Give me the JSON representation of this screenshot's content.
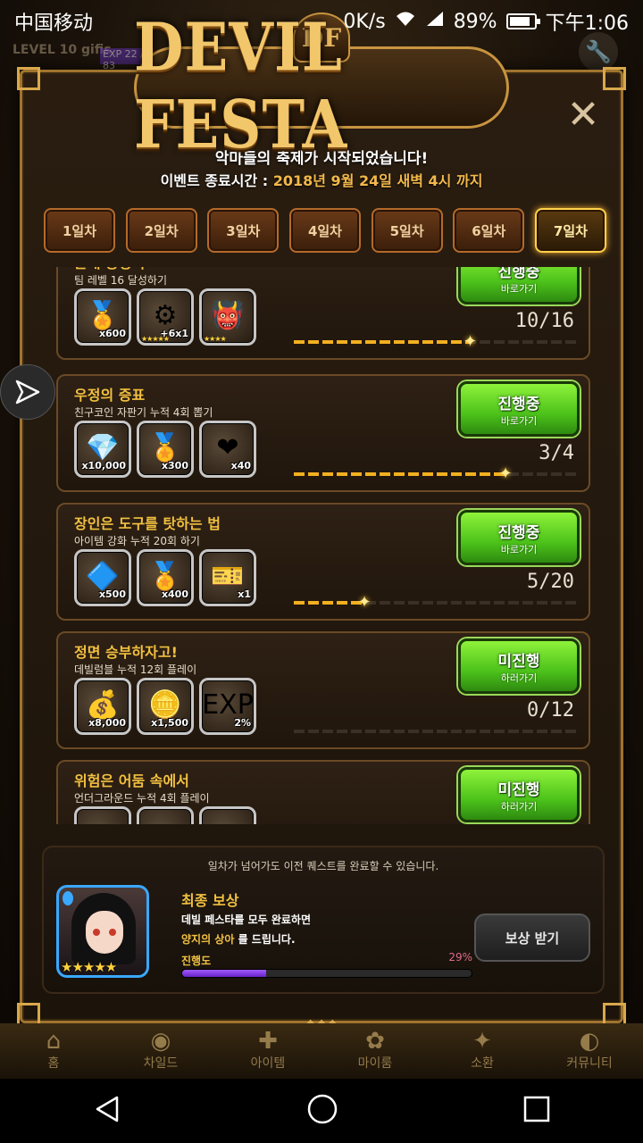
{
  "status_bar": {
    "carrier": "中国移动",
    "speed": "0K/s",
    "battery": "89%",
    "time": "下午1:06"
  },
  "hud": {
    "level_label": "LEVEL 10 gifis",
    "exp_label": "EXP 22 / 83"
  },
  "event": {
    "logo_badge": "DF",
    "logo_text": "DEVIL FESTA",
    "subtitle": "악마들의 축제가 시작되었습니다!",
    "end_label": "이벤트 종료시간 : ",
    "end_date": "2018년 9월 24일 새벽 4시 까지"
  },
  "tabs": [
    {
      "label": "1일차",
      "active": false
    },
    {
      "label": "2일차",
      "active": false
    },
    {
      "label": "3일차",
      "active": false
    },
    {
      "label": "4일차",
      "active": false
    },
    {
      "label": "5일차",
      "active": false
    },
    {
      "label": "6일차",
      "active": false
    },
    {
      "label": "7일차",
      "active": true
    }
  ],
  "quests": [
    {
      "title": "존재 증명서",
      "desc": "팀 레벨 16 달성하기",
      "button_main": "진행중",
      "button_sub": "바로가기",
      "progress_text": "10/16",
      "progress": 0.625,
      "rewards": [
        {
          "icon": "gold-medal-icon",
          "glyph": "🏅",
          "count": "x600",
          "stars": ""
        },
        {
          "icon": "skill-upgrade-icon",
          "glyph": "⚙",
          "count": "+6x1",
          "stars": "★★★★★"
        },
        {
          "icon": "slime-monster-icon",
          "glyph": "👹",
          "count": "",
          "stars": "★★★★"
        }
      ]
    },
    {
      "title": "우정의 증표",
      "desc": "친구코인 자판기 누적 4회 뽑기",
      "button_main": "진행중",
      "button_sub": "바로가기",
      "progress_text": "3/4",
      "progress": 0.75,
      "rewards": [
        {
          "icon": "purple-gem-icon",
          "glyph": "💎",
          "count": "x10,000",
          "stars": ""
        },
        {
          "icon": "gold-medal-icon",
          "glyph": "🏅",
          "count": "x300",
          "stars": ""
        },
        {
          "icon": "heart-icon",
          "glyph": "❤",
          "count": "x40",
          "stars": ""
        }
      ]
    },
    {
      "title": "장인은 도구를 탓하는 법",
      "desc": "아이템 강화 누적 20회 하기",
      "button_main": "진행중",
      "button_sub": "바로가기",
      "progress_text": "5/20",
      "progress": 0.25,
      "rewards": [
        {
          "icon": "rainbow-crystal-icon",
          "glyph": "🔷",
          "count": "x500",
          "stars": ""
        },
        {
          "icon": "gold-medal-icon",
          "glyph": "🏅",
          "count": "x400",
          "stars": ""
        },
        {
          "icon": "ticket-icon",
          "glyph": "🎫",
          "count": "x1",
          "stars": ""
        }
      ]
    },
    {
      "title": "정면 승부하자고!",
      "desc": "데빌럼블 누적 12회 플레이",
      "button_main": "미진행",
      "button_sub": "하러가기",
      "progress_text": "0/12",
      "progress": 0,
      "rewards": [
        {
          "icon": "gold-coins-icon",
          "glyph": "💰",
          "count": "x8,000",
          "stars": ""
        },
        {
          "icon": "silver-coin-icon",
          "glyph": "🪙",
          "count": "x1,500",
          "stars": ""
        },
        {
          "icon": "user-exp-icon",
          "glyph": "EXP",
          "count": "2%",
          "stars": ""
        }
      ]
    },
    {
      "title": "위험은 어둠 속에서",
      "desc": "언더그라운드 누적 4회 플레이",
      "button_main": "미진행",
      "button_sub": "하러가기",
      "progress_text": "",
      "progress": 0,
      "rewards": [
        {
          "icon": "dark-item-icon",
          "glyph": "",
          "count": "",
          "stars": ""
        },
        {
          "icon": "dark-item-icon",
          "glyph": "",
          "count": "",
          "stars": ""
        },
        {
          "icon": "red-item-icon",
          "glyph": "",
          "count": "",
          "stars": ""
        }
      ]
    }
  ],
  "final_reward": {
    "note": "일차가 넘어가도 이전 퀘스트를 완료할 수 있습니다.",
    "title": "최종 보상",
    "desc1": "데빌 페스타를 모두 완료하면",
    "desc2_highlight": "양지의 상아",
    "desc2_rest": " 를 드립니다.",
    "progress_label": "진행도",
    "progress_pct_text": "29%",
    "progress": 0.29,
    "stars": "★★★★★",
    "claim_button": "보상 받기"
  },
  "game_nav": [
    {
      "label": "홈",
      "icon": "home-icon",
      "glyph": "⌂"
    },
    {
      "label": "차일드",
      "icon": "child-icon",
      "glyph": "◉"
    },
    {
      "label": "아이템",
      "icon": "item-icon",
      "glyph": "✚"
    },
    {
      "label": "마이룸",
      "icon": "room-icon",
      "glyph": "✿"
    },
    {
      "label": "소환",
      "icon": "summon-icon",
      "glyph": "✦"
    },
    {
      "label": "커뮤니티",
      "icon": "community-icon",
      "glyph": "◐"
    }
  ],
  "colors": {
    "accent_gold": "#f2c040",
    "button_green": "#4cc21a",
    "progress_purple": "#6a22c8"
  }
}
